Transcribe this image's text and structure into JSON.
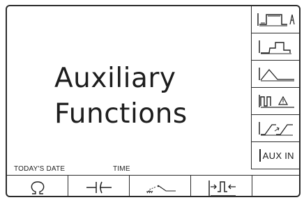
{
  "screen": {
    "title_line1": "Auxiliary",
    "title_line2": "Functions"
  },
  "side_menu": [
    {
      "name": "pulse-train-alarm",
      "icon": "pulse-train-a-icon"
    },
    {
      "name": "pulse-shape",
      "icon": "pulse-shape-icon"
    },
    {
      "name": "ramp",
      "icon": "ramp-icon"
    },
    {
      "name": "pulse-warning",
      "icon": "pulse-warning-icon"
    },
    {
      "name": "slope-adjust",
      "icon": "slope-adjust-icon"
    },
    {
      "name": "aux-in",
      "label": "AUX IN"
    }
  ],
  "status": {
    "date_label": "TODAY'S DATE",
    "time_label": "TIME"
  },
  "bottom_menu": [
    {
      "name": "ohm",
      "icon": "ohm-icon"
    },
    {
      "name": "capacitor",
      "icon": "capacitor-icon"
    },
    {
      "name": "ground-switch",
      "icon": "ground-switch-icon"
    },
    {
      "name": "pulse-input",
      "icon": "pulse-input-icon"
    }
  ]
}
